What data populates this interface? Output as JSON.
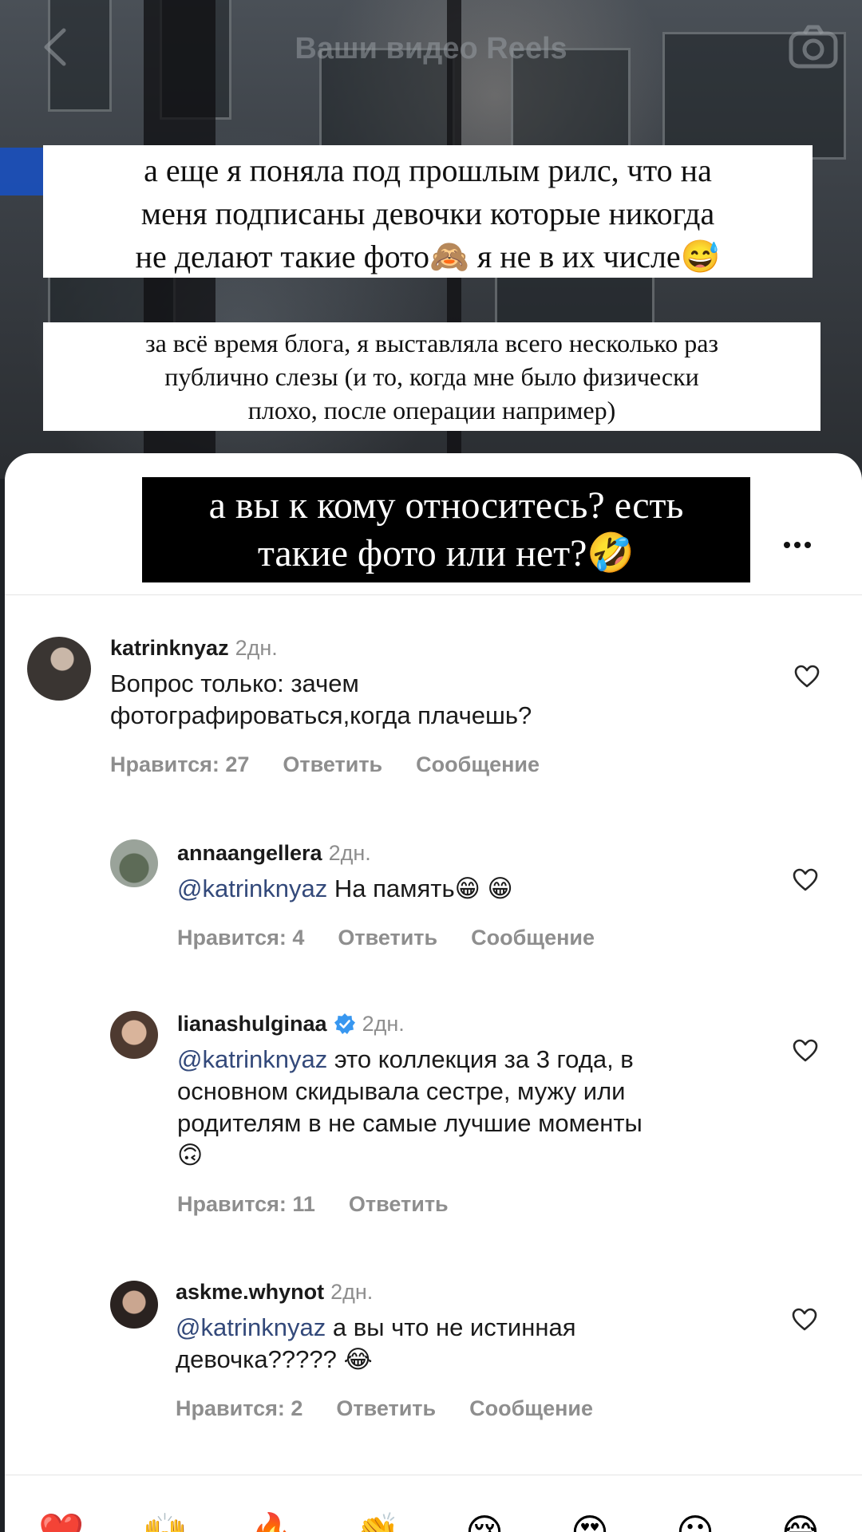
{
  "header": {
    "title": "Ваши видео Reels",
    "back_icon": "chevron-left-icon",
    "camera_icon": "camera-icon"
  },
  "story": {
    "caption1": "а еще я поняла под прошлым рилс, что на\nменя подписаны девочки которые никогда\nне делают такие фото🙈 я не в их числе😅",
    "caption2": "за всё время блога, я выставляла всего несколько раз\nпублично слезы (и то, когда мне было физически\nплохо, после операции например)",
    "question": "а вы к кому относитесь? есть\nтакие фото или нет?🤣"
  },
  "comments": [
    {
      "username": "katrinknyaz",
      "time": "2дн.",
      "text": "Вопрос только: зачем\nфотографироваться,когда плачешь?",
      "likes": "Нравится: 27",
      "reply": "Ответить",
      "message": "Сообщение"
    },
    {
      "username": "annaangellera",
      "time": "2дн.",
      "mention": "@katrinknyaz",
      "text": " На память😁 😁",
      "likes": "Нравится: 4",
      "reply": "Ответить",
      "message": "Сообщение"
    },
    {
      "username": "lianashulginaa",
      "verified": true,
      "time": "2дн.",
      "mention": "@katrinknyaz",
      "text": " это коллекция за 3 года, в\nосновном скидывала сестре, мужу или\nродителям в не самые лучшие моменты\n🙃",
      "likes": "Нравится: 11",
      "reply": "Ответить"
    },
    {
      "username": "askme.whynot",
      "time": "2дн.",
      "mention": "@katrinknyaz",
      "text": " а вы что не истинная\nдевочка????? 😂",
      "likes": "Нравится: 2",
      "reply": "Ответить",
      "message": "Сообщение"
    }
  ],
  "reactions": [
    "❤️",
    "🙌",
    "🔥",
    "👏",
    "😢",
    "😍",
    "😮",
    "😂"
  ],
  "colors": {
    "mention": "#33497a",
    "meta_gray": "#8e8e8e",
    "verified_blue": "#3897f0"
  }
}
